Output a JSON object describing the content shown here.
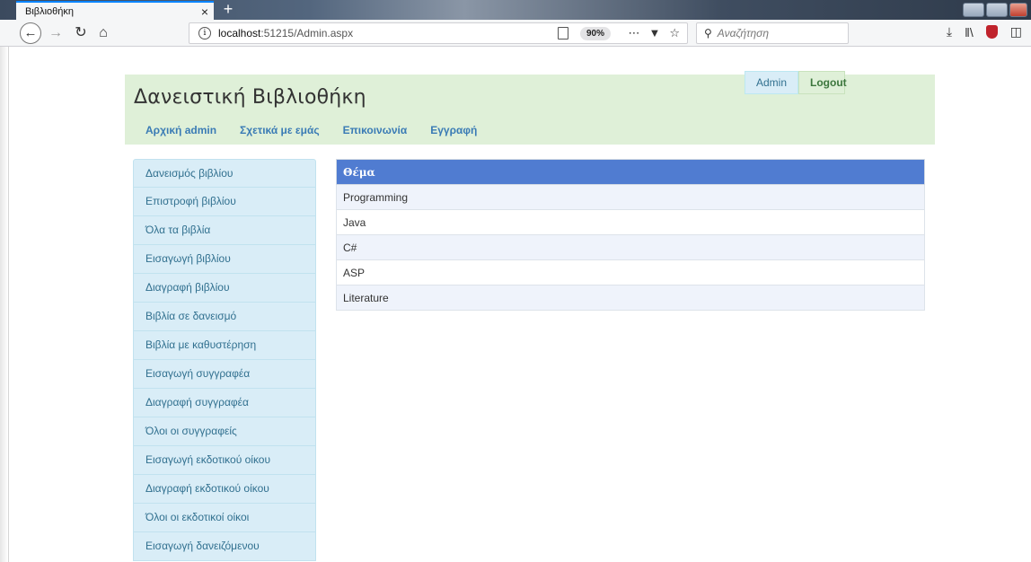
{
  "browser": {
    "tab_title": "Βιβλιοθήκη",
    "tab_close": "×",
    "new_tab": "+",
    "url_host": "localhost",
    "url_rest": ":51215/Admin.aspx",
    "zoom": "90%",
    "search_placeholder": "Αναζήτηση"
  },
  "header": {
    "title": "Δανειστική Βιβλιοθήκη",
    "menu": [
      "Αρχική admin",
      "Σχετικά με εμάς",
      "Επικοινωνία",
      "Εγγραφή"
    ],
    "admin_label": "Admin",
    "logout_label": "Logout"
  },
  "sidebar": {
    "items": [
      "Δανεισμός βιβλίου",
      "Επιστροφή βιβλίου",
      "Όλα τα βιβλία",
      "Εισαγωγή βιβλίου",
      "Διαγραφή βιβλίου",
      "Βιβλία σε δανεισμό",
      "Βιβλία με καθυστέρηση",
      "Εισαγωγή συγγραφέα",
      "Διαγραφή συγγραφέα",
      "Όλοι οι συγγραφείς",
      "Εισαγωγή εκδοτικού οίκου",
      "Διαγραφή εκδοτικού οίκου",
      "Όλοι οι εκδοτικοί οίκοι",
      "Εισαγωγή δανειζόμενου"
    ]
  },
  "table": {
    "header": "Θέμα",
    "rows": [
      "Programming",
      "Java",
      "C#",
      "ASP",
      "Literature"
    ]
  }
}
